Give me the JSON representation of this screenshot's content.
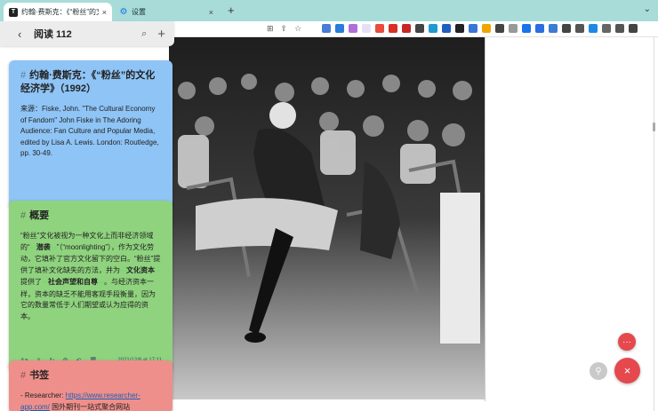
{
  "browser": {
    "tabs": [
      {
        "label": "约翰·费斯克：《“粉丝”的文化",
        "close": "×",
        "favicon": "T"
      },
      {
        "label": "设置",
        "close": "×",
        "favicon": "⚙"
      }
    ],
    "new_tab": "+",
    "menu_chevron": "⌄",
    "extension_colors": [
      "#4a7bd5",
      "#2a7bdc",
      "#b06fd8",
      "#e7e0f4",
      "#e74c3c",
      "#d93025",
      "#c62828",
      "#444",
      "#1d9bd1",
      "#1f5fbf",
      "#222",
      "#3a76d8",
      "#f0a500",
      "#444",
      "#999",
      "#1a73e8",
      "#2b6de0",
      "#3c7bd4",
      "#444",
      "#555",
      "#1e88e5",
      "#666",
      "#555",
      "#444"
    ]
  },
  "sidebar": {
    "back_icon": "‹",
    "title": "阅读 112",
    "search_icon": "⌕",
    "add_icon": "+"
  },
  "cards": {
    "blue": {
      "hash": "#",
      "title": "约翰·费斯克：《“粉丝”的文化经济学》（1992）",
      "body": "来源：Fiske, John. \"The Cultural Economy of Fandom\" John Fiske in The Adoring Audience: Fan Culture and Popular Media, edited by Lisa A. Lewis. London: Routledge, pp. 30-49."
    },
    "green": {
      "hash": "#",
      "title": "概要",
      "body_1": "“粉丝”文化被视为一种文化上而非经济领域的“",
      "mark": "==",
      "bold_1": "潜袭",
      "body_2": "”（“moonlighting”），作为文化劳动，它填补了官方文化留下的空白。“粉丝”提供了填补文化缺失的方法，并为",
      "bold_2": "文化资本",
      "body_3": "提供了",
      "bold_3": "社会声望和自尊",
      "body_4": "。与经济资本一样，资本的缺乏不能用客观手段衡量，因为它的数量常低于人们期望或认为应得的资本。",
      "meta": {
        "font_label": "Aa",
        "share_icon": "⇪",
        "refresh_icon": "↻",
        "settings_icon": "⚙",
        "undo_icon": "↶",
        "trash_icon": "🗑",
        "timestamp": "2021/12/8 at 17:11"
      }
    },
    "red": {
      "hash": "#",
      "title": "书签",
      "bullet": "-",
      "researcher_label": "Researcher:",
      "researcher_link": "https://www.researcher-app.com/",
      "researcher_desc": "国外期刊一站式聚合网站"
    }
  },
  "fabs": {
    "more_icon": "···",
    "close_icon": "×",
    "pin_icon": "⚲"
  }
}
